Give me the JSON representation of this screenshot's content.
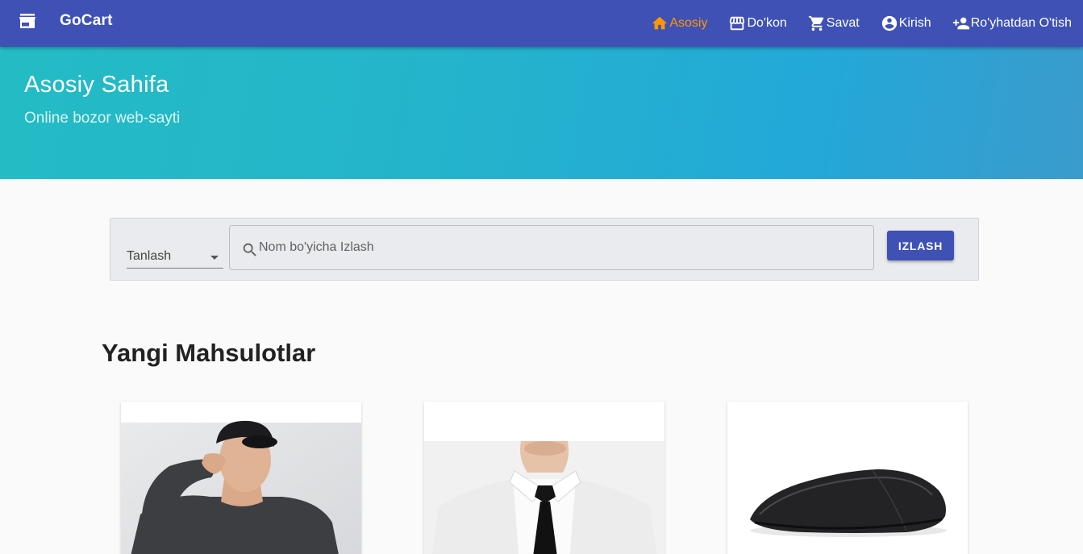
{
  "header": {
    "brand": "GoCart",
    "brand_icon": "store-icon",
    "nav": [
      {
        "label": "Asosiy",
        "icon": "home-icon",
        "active": true
      },
      {
        "label": "Do'kon",
        "icon": "storefront-icon",
        "active": false
      },
      {
        "label": "Savat",
        "icon": "cart-icon",
        "active": false
      },
      {
        "label": "Kirish",
        "icon": "account-circle-icon",
        "active": false
      },
      {
        "label": "Ro'yhatdan O'tish",
        "icon": "person-add-icon",
        "active": false
      }
    ],
    "colors": {
      "bar": "#3f51b5",
      "active": "#ff9800"
    }
  },
  "hero": {
    "title": "Asosiy Sahifa",
    "subtitle": "Online bozor web-sayti"
  },
  "search": {
    "select_value": "Tanlash",
    "placeholder": "Nom bo'yicha Izlash",
    "value": "",
    "button_label": "IZLASH"
  },
  "products_section": {
    "title": "Yangi Mahsulotlar",
    "products": [
      {
        "image": "man-in-cap-photo"
      },
      {
        "image": "white-shirt-black-tie-photo"
      },
      {
        "image": "black-wireless-mouse-photo"
      }
    ]
  }
}
